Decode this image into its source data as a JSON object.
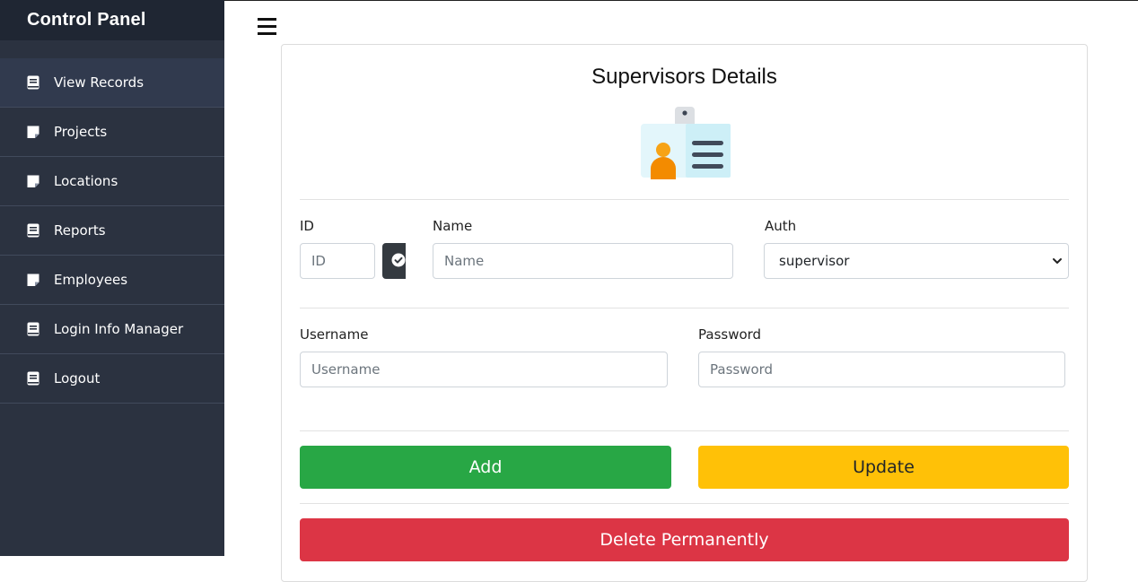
{
  "sidebar": {
    "title": "Control Panel",
    "items": [
      {
        "label": "View Records",
        "icon": "book-icon",
        "active": true
      },
      {
        "label": "Projects",
        "icon": "sticky-note-icon"
      },
      {
        "label": "Locations",
        "icon": "sticky-note-icon"
      },
      {
        "label": "Reports",
        "icon": "book-icon"
      },
      {
        "label": "Employees",
        "icon": "sticky-note-icon"
      },
      {
        "label": "Login Info Manager",
        "icon": "book-icon"
      },
      {
        "label": "Logout",
        "icon": "book-icon"
      }
    ]
  },
  "header": {
    "menu_icon": "hamburger-icon"
  },
  "form": {
    "title": "Supervisors Details",
    "illustration": "id-badge-icon",
    "id": {
      "label": "ID",
      "placeholder": "ID",
      "value": ""
    },
    "check_icon": "check-circle-icon",
    "name": {
      "label": "Name",
      "placeholder": "Name",
      "value": ""
    },
    "auth": {
      "label": "Auth",
      "selected": "supervisor"
    },
    "username": {
      "label": "Username",
      "placeholder": "Username",
      "value": ""
    },
    "password": {
      "label": "Password",
      "placeholder": "Password",
      "value": ""
    },
    "buttons": {
      "add": "Add",
      "update": "Update",
      "delete": "Delete Permanently"
    }
  },
  "colors": {
    "sidebar_bg": "#2b3240",
    "sidebar_header_bg": "#1f2633",
    "add": "#28a745",
    "update": "#ffc107",
    "delete": "#dc3545"
  }
}
